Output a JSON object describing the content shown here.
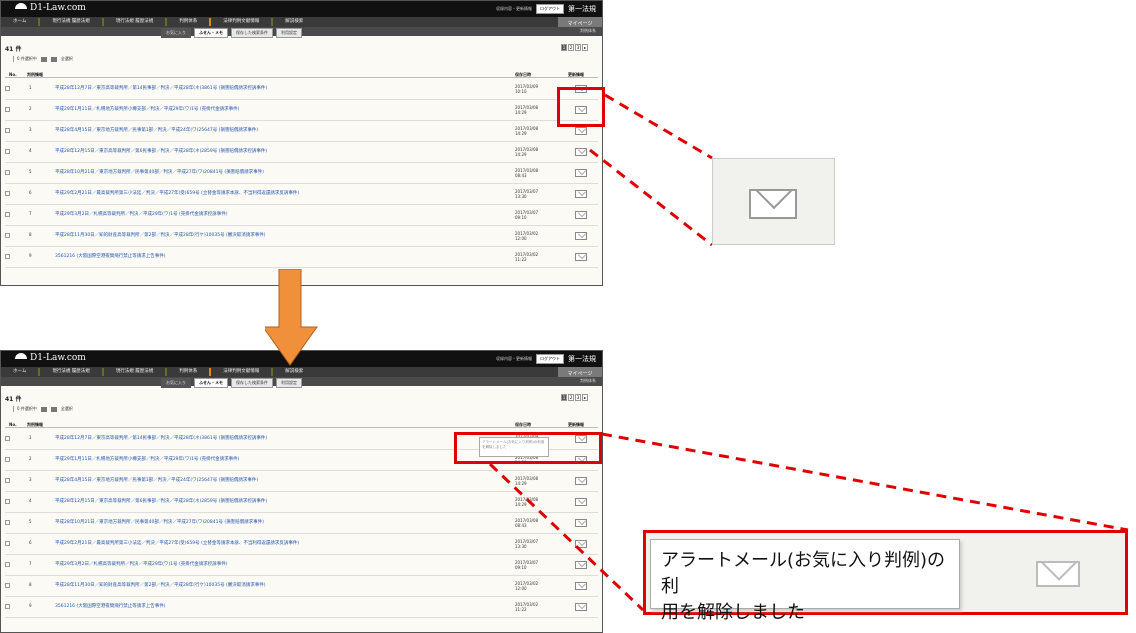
{
  "app": {
    "logo_text": "D1-Law.com",
    "header_links": "収録内容・更新情報",
    "logout_label": "ログアウト",
    "brand": "第一法規",
    "nav": [
      "ホーム",
      "現行法規 履歴法規",
      "現行法規 履歴法規",
      "判例体系",
      "法律判例文献情報",
      "解説検索"
    ],
    "mypage": "マイページ",
    "sub_right": "判例体系",
    "subtabs": [
      "お気に入り",
      "ふせん・メモ",
      "保存した検索条件",
      "利用設定"
    ],
    "count": "41 件",
    "pages": [
      "1",
      "2",
      "3",
      "▸"
    ],
    "controls": {
      "selected": "0 件選択中",
      "select_all": "全選択"
    },
    "columns": {
      "no": "No.",
      "title": "判例情報",
      "date": "保存日時",
      "update": "更新情報"
    }
  },
  "rows": [
    {
      "no": "1",
      "title": "平成28年12月7日／東京高等裁判所／第14民事部／判決／平成28年(ネ)3861号 (損害賠償請求控訴事件)",
      "date": "2017/03/09",
      "time": "10:10"
    },
    {
      "no": "2",
      "title": "平成29年1月11日／札幌地方裁判所小樽支部／判決／平成29年(ワ)1号 (売掛代金請求事件)",
      "date": "2017/03/08",
      "time": "14:29"
    },
    {
      "no": "3",
      "title": "平成28年4月15日／東京地方裁判所／民事第1部／判決／平成24年(ワ)25647号 (損害賠償請求事件)",
      "date": "2017/03/08",
      "time": "14:29"
    },
    {
      "no": "4",
      "title": "平成28年12月15日／東京高等裁判所／第6民事部／判決／平成28年(ネ)2859号 (損害賠償請求控訴事件)",
      "date": "2017/03/08",
      "time": "14:29"
    },
    {
      "no": "5",
      "title": "平成28年10月21日／東京地方裁判所／民事第40部／判決／平成27年(ワ)20841号 (損害賠償請求事件)",
      "date": "2017/03/08",
      "time": "08:43"
    },
    {
      "no": "6",
      "title": "平成29年2月21日／最高裁判所第三小法廷／判決／平成27年(受)659号 (立替金等請求本訴、不当利得返還請求反訴事件)",
      "date": "2017/03/07",
      "time": "13:30"
    },
    {
      "no": "7",
      "title": "平成29年3月2日／札幌高等裁判所／判決／平成29年(ワ)1号 (売掛代金請求控訴事件)",
      "date": "2017/03/07",
      "time": "09:10"
    },
    {
      "no": "8",
      "title": "平成28年11月30日／知的財産高等裁判所／第2部／判決／平成28年(行ケ)10035号 (審決取消請求事件)",
      "date": "2017/03/02",
      "time": "12:00"
    },
    {
      "no": "9",
      "title": "3561216 (大阪国際空港夜間飛行禁止等請求上告事件)",
      "date": "2017/03/02",
      "time": "11:22"
    }
  ],
  "tooltip": {
    "line1": "アラートメール(お気に入り判例)の利",
    "line2": "用を解除しました",
    "mini": "アラートメール(お気に入り判例)の利用を解除しました"
  },
  "colors": {
    "accent_red": "#e00000",
    "arrow": "#f0903a",
    "link": "#2255aa"
  }
}
